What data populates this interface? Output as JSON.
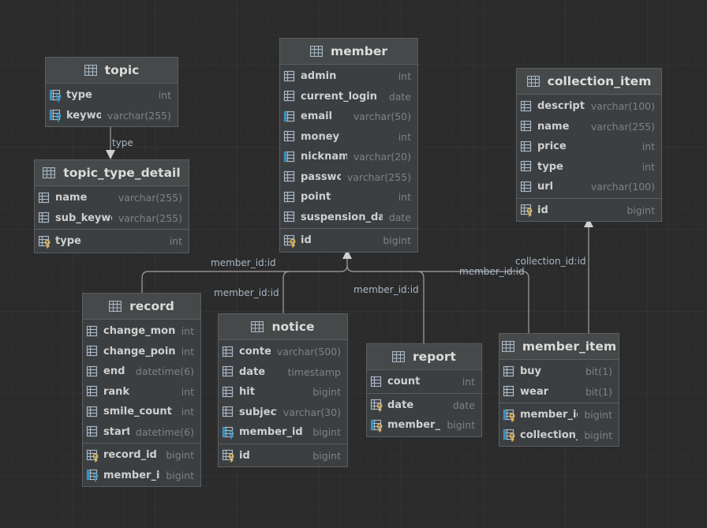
{
  "tables": [
    {
      "key": "topic",
      "title": "topic",
      "sections": [
        [
          {
            "name": "type",
            "type": "int",
            "icon": "fk-index"
          },
          {
            "name": "keyword",
            "type": "varchar(255)",
            "icon": "fk-index"
          }
        ]
      ]
    },
    {
      "key": "topic_type_detail",
      "title": "topic_type_detail",
      "sections": [
        [
          {
            "name": "name",
            "type": "varchar(255)",
            "icon": "column"
          },
          {
            "name": "sub_keyword",
            "type": "varchar(255)",
            "icon": "column"
          }
        ],
        [
          {
            "name": "type",
            "type": "int",
            "icon": "pk"
          }
        ]
      ]
    },
    {
      "key": "member",
      "title": "member",
      "sections": [
        [
          {
            "name": "admin",
            "type": "int",
            "icon": "column"
          },
          {
            "name": "current_login",
            "type": "date",
            "icon": "column"
          },
          {
            "name": "email",
            "type": "varchar(50)",
            "icon": "index"
          },
          {
            "name": "money",
            "type": "int",
            "icon": "column"
          },
          {
            "name": "nickname",
            "type": "varchar(20)",
            "icon": "index"
          },
          {
            "name": "password",
            "type": "varchar(255)",
            "icon": "column"
          },
          {
            "name": "point",
            "type": "int",
            "icon": "column"
          },
          {
            "name": "suspension_day",
            "type": "date",
            "icon": "column"
          }
        ],
        [
          {
            "name": "id",
            "type": "bigint",
            "icon": "pk"
          }
        ]
      ]
    },
    {
      "key": "collection_item",
      "title": "collection_item",
      "sections": [
        [
          {
            "name": "description",
            "type": "varchar(100)",
            "icon": "column"
          },
          {
            "name": "name",
            "type": "varchar(255)",
            "icon": "column"
          },
          {
            "name": "price",
            "type": "int",
            "icon": "column"
          },
          {
            "name": "type",
            "type": "int",
            "icon": "column"
          },
          {
            "name": "url",
            "type": "varchar(100)",
            "icon": "column"
          }
        ],
        [
          {
            "name": "id",
            "type": "bigint",
            "icon": "pk"
          }
        ]
      ]
    },
    {
      "key": "record",
      "title": "record",
      "sections": [
        [
          {
            "name": "change_money",
            "type": "int",
            "icon": "column"
          },
          {
            "name": "change_point",
            "type": "int",
            "icon": "column"
          },
          {
            "name": "end",
            "type": "datetime(6)",
            "icon": "column"
          },
          {
            "name": "rank",
            "type": "int",
            "icon": "column"
          },
          {
            "name": "smile_count",
            "type": "int",
            "icon": "column"
          },
          {
            "name": "start",
            "type": "datetime(6)",
            "icon": "column"
          }
        ],
        [
          {
            "name": "record_id",
            "type": "bigint",
            "icon": "pk"
          },
          {
            "name": "member_id",
            "type": "bigint",
            "icon": "fk-index"
          }
        ]
      ]
    },
    {
      "key": "notice",
      "title": "notice",
      "sections": [
        [
          {
            "name": "content",
            "type": "varchar(500)",
            "icon": "column"
          },
          {
            "name": "date",
            "type": "timestamp",
            "icon": "column"
          },
          {
            "name": "hit",
            "type": "bigint",
            "icon": "column"
          },
          {
            "name": "subject",
            "type": "varchar(30)",
            "icon": "column"
          },
          {
            "name": "member_id",
            "type": "bigint",
            "icon": "fk-index"
          }
        ],
        [
          {
            "name": "id",
            "type": "bigint",
            "icon": "pk"
          }
        ]
      ]
    },
    {
      "key": "report",
      "title": "report",
      "sections": [
        [
          {
            "name": "count",
            "type": "int",
            "icon": "column"
          }
        ],
        [
          {
            "name": "date",
            "type": "date",
            "icon": "pk"
          },
          {
            "name": "member_id",
            "type": "bigint",
            "icon": "pk-fk"
          }
        ]
      ]
    },
    {
      "key": "member_item",
      "title": "member_item",
      "sections": [
        [
          {
            "name": "buy",
            "type": "bit(1)",
            "icon": "column"
          },
          {
            "name": "wear",
            "type": "bit(1)",
            "icon": "column"
          }
        ],
        [
          {
            "name": "member_id",
            "type": "bigint",
            "icon": "pk-fk"
          },
          {
            "name": "collection_id",
            "type": "bigint",
            "icon": "pk-fk"
          }
        ]
      ]
    }
  ],
  "relations": [
    {
      "key": "topic_type",
      "label": "type"
    },
    {
      "key": "record_member",
      "label": "member_id:id"
    },
    {
      "key": "notice_member",
      "label": "member_id:id"
    },
    {
      "key": "report_member",
      "label": "member_id:id"
    },
    {
      "key": "member_item_member",
      "label": "member_id:id"
    },
    {
      "key": "member_item_collection",
      "label": "collection_id:id"
    }
  ],
  "colors": {
    "line": "#a3a3a3",
    "column_icon": "#a9b7c6",
    "index_icon": "#3592c4",
    "key_icon": "#e8b84b"
  }
}
